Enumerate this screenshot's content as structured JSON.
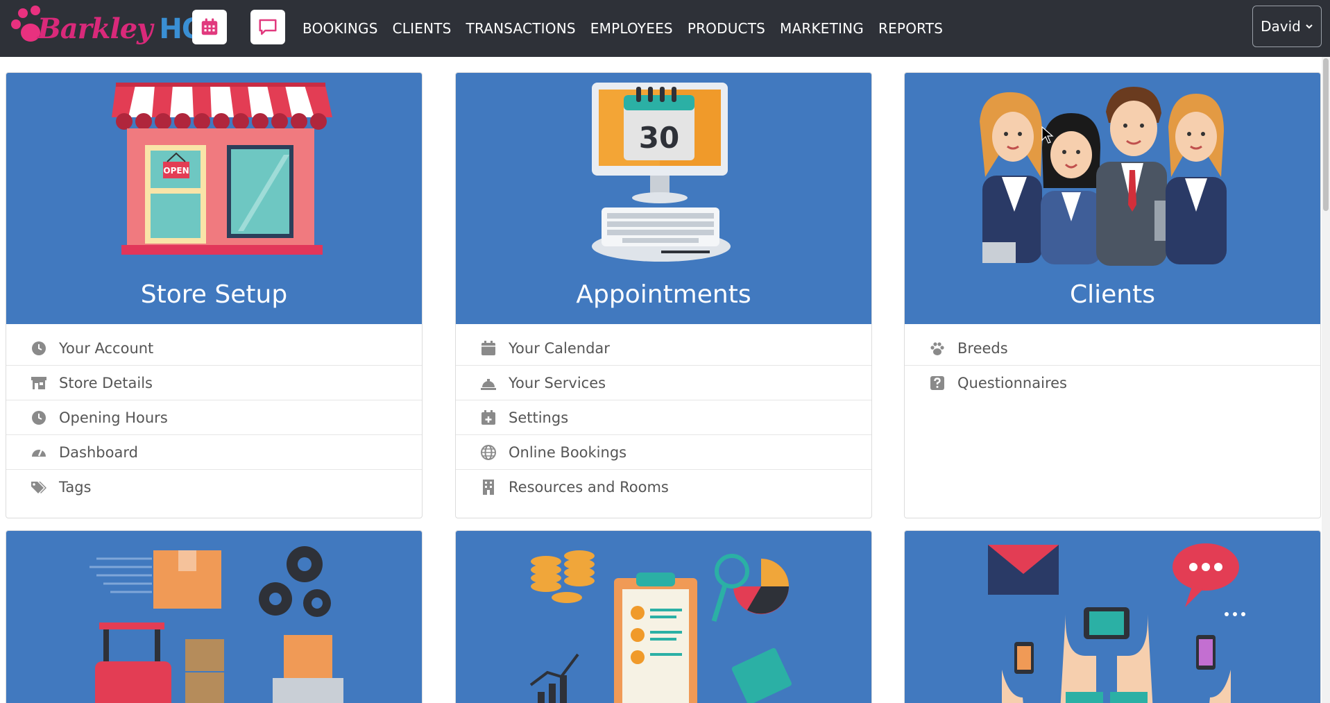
{
  "app": {
    "logo_brand": "Barkley",
    "logo_suffix": "HQ"
  },
  "nav": {
    "items": [
      {
        "label": "BOOKINGS"
      },
      {
        "label": "CLIENTS"
      },
      {
        "label": "TRANSACTIONS"
      },
      {
        "label": "EMPLOYEES"
      },
      {
        "label": "PRODUCTS"
      },
      {
        "label": "MARKETING"
      },
      {
        "label": "REPORTS"
      }
    ],
    "user": "David",
    "calendar_icon": "calendar-icon",
    "chat_icon": "chat-icon"
  },
  "cards": {
    "store_setup": {
      "title": "Store Setup",
      "items": [
        {
          "label": "Your Account",
          "icon": "clock-icon"
        },
        {
          "label": "Store Details",
          "icon": "store-icon"
        },
        {
          "label": "Opening Hours",
          "icon": "clock-icon"
        },
        {
          "label": "Dashboard",
          "icon": "gauge-icon"
        },
        {
          "label": "Tags",
          "icon": "tags-icon"
        }
      ]
    },
    "appointments": {
      "title": "Appointments",
      "calendar_day": "30",
      "items": [
        {
          "label": "Your Calendar",
          "icon": "calendar-icon"
        },
        {
          "label": "Your Services",
          "icon": "service-bell-icon"
        },
        {
          "label": "Settings",
          "icon": "calendar-plus-icon"
        },
        {
          "label": "Online Bookings",
          "icon": "globe-icon"
        },
        {
          "label": "Resources and Rooms",
          "icon": "building-icon"
        }
      ]
    },
    "clients": {
      "title": "Clients",
      "items": [
        {
          "label": "Breeds",
          "icon": "paw-icon"
        },
        {
          "label": "Questionnaires",
          "icon": "question-square-icon"
        }
      ]
    },
    "store_sign": "OPEN"
  },
  "colors": {
    "topbar": "#2e3138",
    "card_blue": "#4179bf",
    "brand_pink": "#e8317f",
    "brand_blue": "#3a8fd4"
  }
}
